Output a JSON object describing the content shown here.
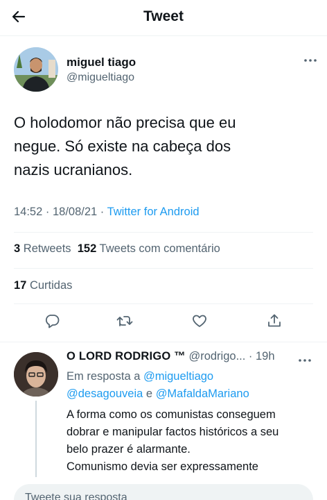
{
  "header": {
    "title": "Tweet",
    "back_icon": "arrow-left-icon"
  },
  "tweet": {
    "author": {
      "name": "miguel tiago",
      "handle": "@migueltiago"
    },
    "text_lines": [
      "O holodomor não precisa que eu",
      "negue. Só existe na cabeça dos",
      "nazis ucranianos."
    ],
    "time": "14:52",
    "sep1": " · ",
    "date": "18/08/21",
    "sep2": " · ",
    "source": "Twitter for Android",
    "retweets_count": "3",
    "retweets_label": " Retweets",
    "quotes_count": "152",
    "quotes_label": " Tweets com comentário",
    "likes_count": "17",
    "likes_label": " Curtidas",
    "actions": [
      "reply-icon",
      "retweet-icon",
      "like-icon",
      "share-icon"
    ]
  },
  "reply": {
    "name": "O LORD RODRIGO ™",
    "handle": " @rodrigo...",
    "time": " · 19h",
    "in_reply_prefix": "Em resposta a ",
    "mention1": "@migueltiago",
    "mention2": "@desagouveia",
    "and_word": " e ",
    "mention3": "@MafaldaMariano",
    "text_lines": [
      "A forma como os comunistas conseguem",
      "dobrar e manipular factos históricos a seu",
      "belo prazer é alarmante.",
      "Comunismo devia ser expressamente"
    ]
  },
  "composer": {
    "placeholder": "Tweete sua resposta"
  },
  "colors": {
    "accent": "#1d9bf0",
    "secondary_text": "#536471",
    "primary_text": "#0f1419",
    "divider": "#eff3f4"
  }
}
